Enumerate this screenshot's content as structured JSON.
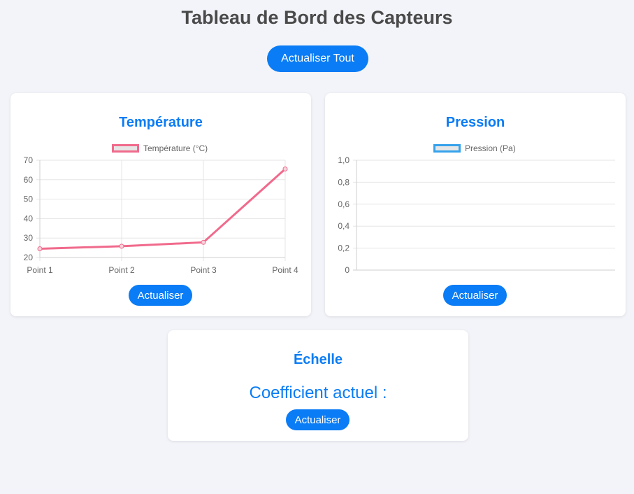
{
  "header": {
    "title": "Tableau de Bord des Capteurs",
    "refresh_all_label": "Actualiser Tout"
  },
  "temperature_card": {
    "title": "Température",
    "legend_label": "Température (°C)",
    "refresh_label": "Actualiser",
    "series_color": "#f06a8c"
  },
  "pressure_card": {
    "title": "Pression",
    "legend_label": "Pression (Pa)",
    "refresh_label": "Actualiser",
    "series_color": "#36a2eb"
  },
  "scale_card": {
    "title": "Échelle",
    "coefficient_label": "Coefficient actuel :",
    "refresh_label": "Actualiser"
  },
  "colors": {
    "accent": "#0a7cf5",
    "background": "#f3f4f9"
  },
  "chart_data": [
    {
      "type": "line",
      "title": "Température",
      "categories": [
        "Point 1",
        "Point 2",
        "Point 3",
        "Point 4"
      ],
      "series": [
        {
          "name": "Température (°C)",
          "values": [
            24.5,
            25.8,
            27.8,
            65.5
          ]
        }
      ],
      "ylim": [
        20,
        70
      ],
      "yticks": [
        "70",
        "60",
        "50",
        "40",
        "30",
        "20"
      ],
      "grid": true,
      "legend": "top"
    },
    {
      "type": "line",
      "title": "Pression",
      "categories": [],
      "series": [
        {
          "name": "Pression (Pa)",
          "values": []
        }
      ],
      "ylim": [
        0,
        1
      ],
      "yticks": [
        "1,0",
        "0,8",
        "0,6",
        "0,4",
        "0,2",
        "0"
      ],
      "grid": true,
      "legend": "top"
    }
  ]
}
